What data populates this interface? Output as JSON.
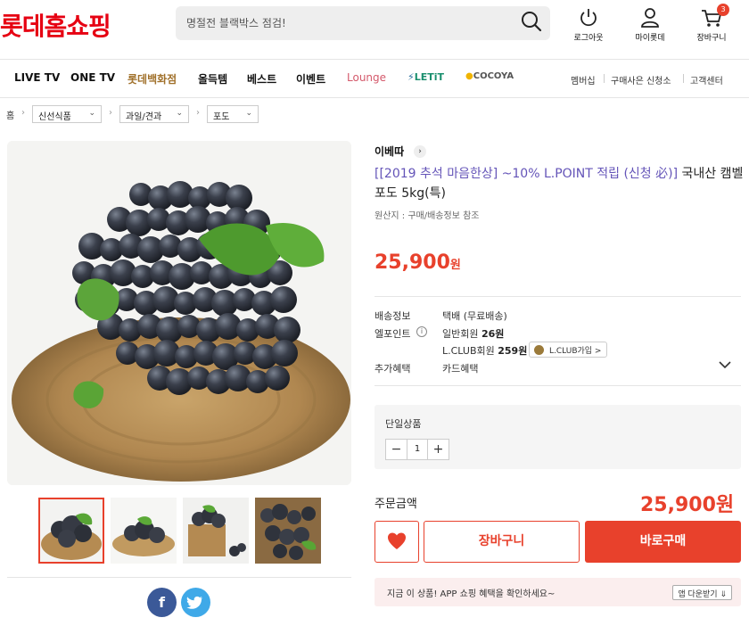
{
  "header": {
    "logo": "롯데홈쇼핑",
    "search_placeholder": "명절전 블랙박스 점검!",
    "util": {
      "logout": "로그아웃",
      "mypage": "마이롯데",
      "cart": "장바구니",
      "cart_count": "3"
    }
  },
  "nav": {
    "items": [
      "LIVE TV",
      "ONE TV",
      "롯데백화점",
      "올득템",
      "베스트",
      "이벤트",
      "Lounge",
      "LETiT",
      "COCOYA"
    ],
    "util": [
      "멤버십",
      "구매사은 신청소",
      "고객센터"
    ]
  },
  "breadcrumb": {
    "home": "홈",
    "levels": [
      "신선식품",
      "과일/견과",
      "포도"
    ]
  },
  "product": {
    "brand": "이베따",
    "title_promo": "[[2019 추석 마음한상] ~10% L.POINT 적립 (신청 必)]",
    "title_main": " 국내산 캠벨 포도 5kg(특)",
    "origin": "원산지 : 구매/배송정보 참조",
    "price": "25,900",
    "price_unit": "원"
  },
  "info": {
    "shipping_label": "배송정보",
    "shipping_value": "택배 (무료배송)",
    "lpoint_label": "엘포인트",
    "lpoint_general_label": "일반회원 ",
    "lpoint_general_value": "26원",
    "lpoint_lclub_label": "L.CLUB회원 ",
    "lpoint_lclub_value": "259원",
    "lclub_button": "L.CLUB가입 >",
    "benefit_label": "추가혜택",
    "benefit_value": "카드혜택"
  },
  "option": {
    "title": "단일상품",
    "quantity": "1",
    "minus": "−",
    "plus": "+"
  },
  "order": {
    "total_label": "주문금액",
    "total_price": "25,900원",
    "cart_button": "장바구니",
    "buy_button": "바로구매"
  },
  "banner": {
    "text": "지금 이 상품! APP 쇼핑 혜택을 확인하세요~",
    "button": "앱 다운받기 ⇓"
  },
  "share": {
    "facebook": "f"
  },
  "colors": {
    "brand_red": "#e60012",
    "accent": "#e8412c",
    "promo": "#6454b8",
    "facebook": "#3b5998",
    "twitter": "#3fa9e8"
  }
}
